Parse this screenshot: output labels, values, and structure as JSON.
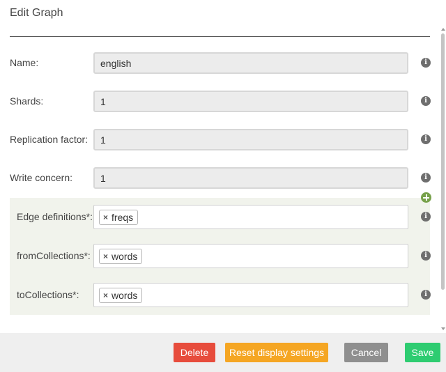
{
  "modal": {
    "title": "Edit Graph"
  },
  "fields": [
    {
      "label": "Name:",
      "value": "english"
    },
    {
      "label": "Shards:",
      "value": "1"
    },
    {
      "label": "Replication factor:",
      "value": "1"
    },
    {
      "label": "Write concern:",
      "value": "1"
    }
  ],
  "edge_definitions": [
    {
      "label": "Edge definitions*:",
      "tags": [
        "freqs"
      ]
    },
    {
      "label": "fromCollections*:",
      "tags": [
        "words"
      ]
    },
    {
      "label": "toCollections*:",
      "tags": [
        "words"
      ]
    }
  ],
  "icons": {
    "info": "info-icon",
    "add": "add-icon",
    "remove_tag": "close-icon"
  },
  "info_glyph": "i",
  "tag_remove_glyph": "×",
  "footer": {
    "delete_label": "Delete",
    "reset_label": "Reset display settings",
    "cancel_label": "Cancel",
    "save_label": "Save"
  },
  "colors": {
    "delete": "#e74c3c",
    "reset": "#f5a623",
    "cancel": "#8f8f8f",
    "save": "#2ecc71",
    "add": "#77a14a"
  }
}
